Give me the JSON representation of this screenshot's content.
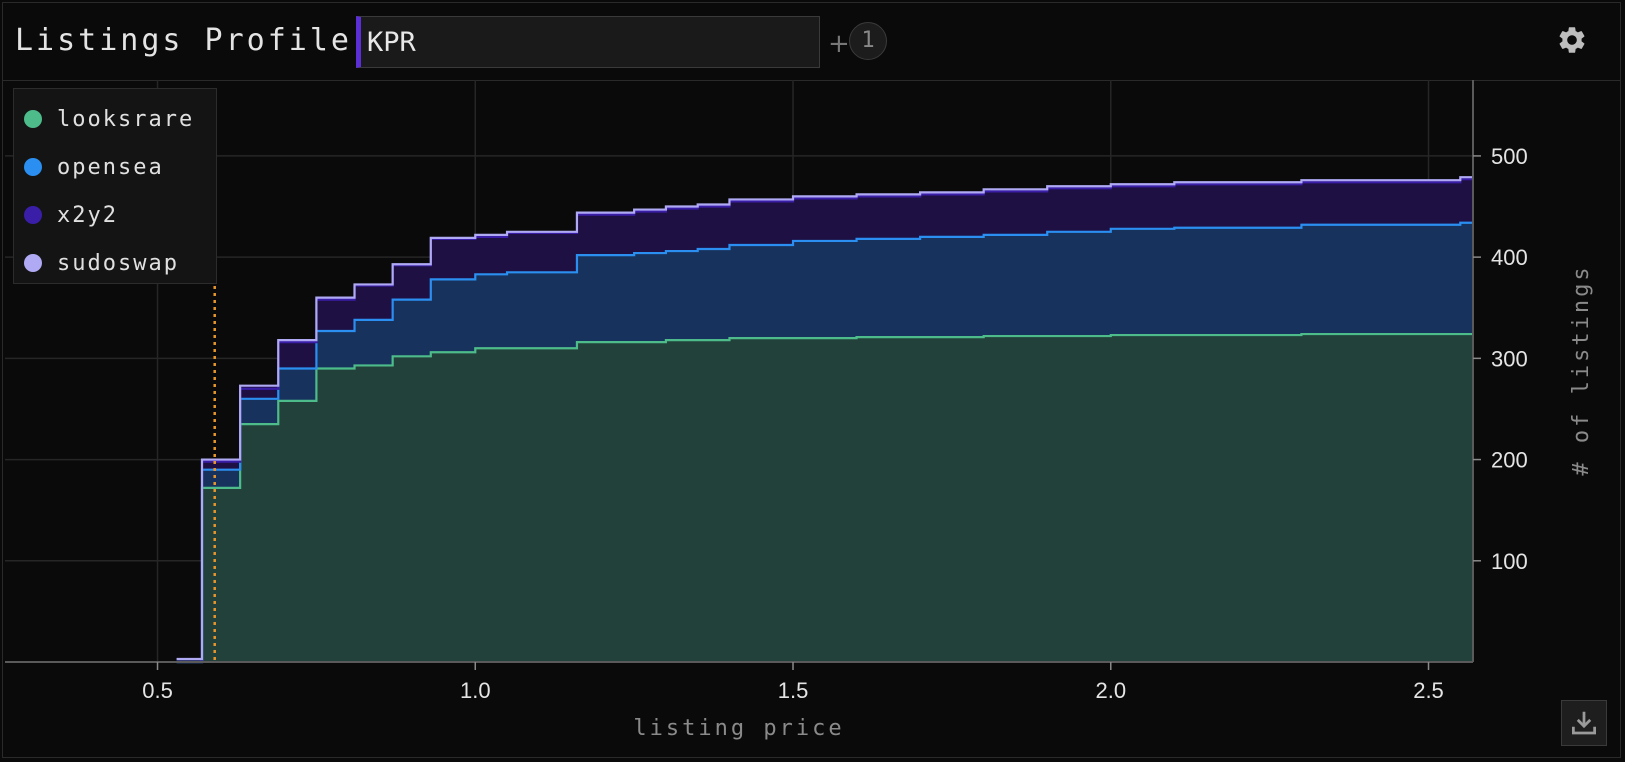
{
  "header": {
    "title": "Listings Profile",
    "search_value": "KPR",
    "plus_label": "+",
    "badge_count": "1"
  },
  "icons": {
    "settings": "gear-icon",
    "download": "download-icon"
  },
  "colors": {
    "looksrare": "#4dbb8a",
    "opensea": "#2a8ff0",
    "x2y2": "#3a1ea8",
    "sudoswap": "#b0aaf5",
    "marker": "#e8962a"
  },
  "legend": [
    {
      "label": "looksrare",
      "color": "#4dbb8a"
    },
    {
      "label": "opensea",
      "color": "#2a8ff0"
    },
    {
      "label": "x2y2",
      "color": "#3a1ea8"
    },
    {
      "label": "sudoswap",
      "color": "#b0aaf5"
    }
  ],
  "chart_data": {
    "type": "area",
    "stacked": true,
    "step": true,
    "xlabel": "listing price",
    "ylabel": "# of listings",
    "xlim": [
      0.26,
      2.57
    ],
    "ylim": [
      0,
      575
    ],
    "xticks": [
      0.5,
      1.0,
      1.5,
      2.0,
      2.5
    ],
    "xtick_labels": [
      "0.5",
      "1.0",
      "1.5",
      "2.0",
      "2.5"
    ],
    "yticks": [
      100,
      200,
      300,
      400,
      500
    ],
    "ytick_labels": [
      "100",
      "200",
      "300",
      "400",
      "500"
    ],
    "y_axis_side": "right",
    "grid": true,
    "legend_position": "top-left",
    "marker_x": 0.59,
    "x": [
      0.53,
      0.56,
      0.57,
      0.62,
      0.63,
      0.68,
      0.69,
      0.74,
      0.75,
      0.8,
      0.81,
      0.86,
      0.87,
      0.92,
      0.93,
      0.97,
      1.0,
      1.05,
      1.1,
      1.15,
      1.16,
      1.25,
      1.3,
      1.35,
      1.4,
      1.5,
      1.6,
      1.7,
      1.8,
      1.9,
      2.0,
      2.1,
      2.3,
      2.55
    ],
    "series": [
      {
        "name": "looksrare",
        "values": [
          0,
          0,
          172,
          172,
          235,
          235,
          258,
          258,
          290,
          290,
          293,
          293,
          302,
          302,
          306,
          306,
          310,
          310,
          310,
          310,
          316,
          316,
          318,
          318,
          320,
          320,
          321,
          321,
          322,
          322,
          323,
          323,
          324,
          324
        ]
      },
      {
        "name": "opensea",
        "values": [
          0,
          0,
          190,
          190,
          260,
          260,
          290,
          290,
          327,
          327,
          338,
          338,
          358,
          358,
          378,
          378,
          383,
          385,
          385,
          385,
          402,
          404,
          406,
          408,
          412,
          416,
          418,
          420,
          422,
          425,
          428,
          429,
          432,
          434
        ]
      },
      {
        "name": "x2y2",
        "values": [
          0,
          0,
          198,
          198,
          270,
          270,
          316,
          316,
          358,
          358,
          372,
          372,
          392,
          392,
          418,
          418,
          420,
          424,
          424,
          424,
          442,
          445,
          448,
          450,
          455,
          458,
          460,
          462,
          465,
          468,
          470,
          472,
          474,
          477
        ]
      },
      {
        "name": "sudoswap",
        "values": [
          3,
          3,
          200,
          200,
          273,
          273,
          318,
          318,
          360,
          360,
          373,
          373,
          393,
          393,
          419,
          419,
          422,
          425,
          425,
          425,
          444,
          447,
          450,
          452,
          457,
          460,
          462,
          464,
          467,
          470,
          472,
          474,
          476,
          479
        ]
      }
    ]
  }
}
